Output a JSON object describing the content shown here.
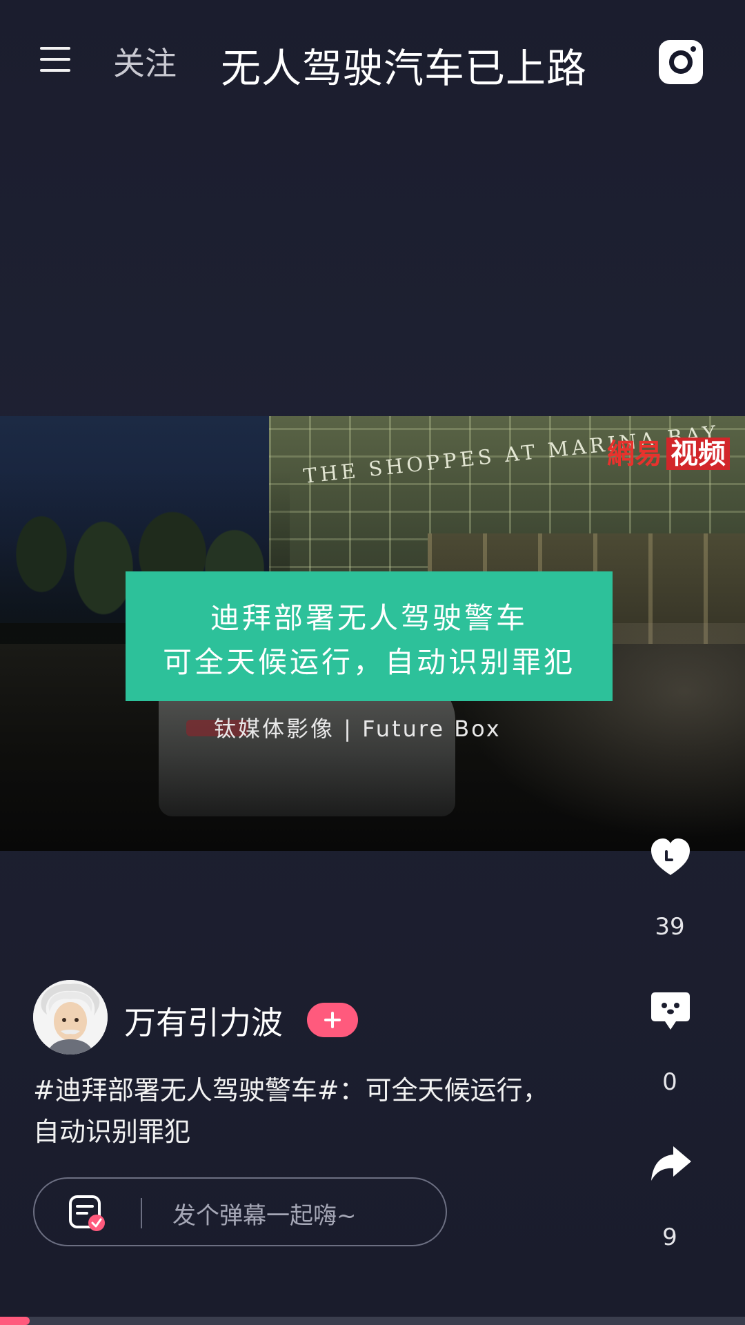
{
  "header": {
    "follow_tab": "关注",
    "title": "无人驾驶汽车已上路"
  },
  "video": {
    "building_sign": "THE SHOPPES AT MARINA BAY",
    "watermark_left": "網易",
    "watermark_right": "视频",
    "caption_line1": "迪拜部署无人驾驶警车",
    "caption_line2": "可全天候运行，自动识别罪犯",
    "credit": "钛媒体影像 | Future Box",
    "progress": 0.04
  },
  "actions": {
    "likes": "39",
    "comments": "0",
    "shares": "9"
  },
  "author": {
    "name": "万有引力波"
  },
  "description": "#迪拜部署无人驾驶警车#：可全天候运行，自动识别罪犯",
  "danmaku": {
    "placeholder": "发个弹幕一起嗨~"
  },
  "colors": {
    "accent_pink": "#ff5a7d",
    "caption_green": "#2dc19a",
    "background": "#1b1d2e"
  }
}
